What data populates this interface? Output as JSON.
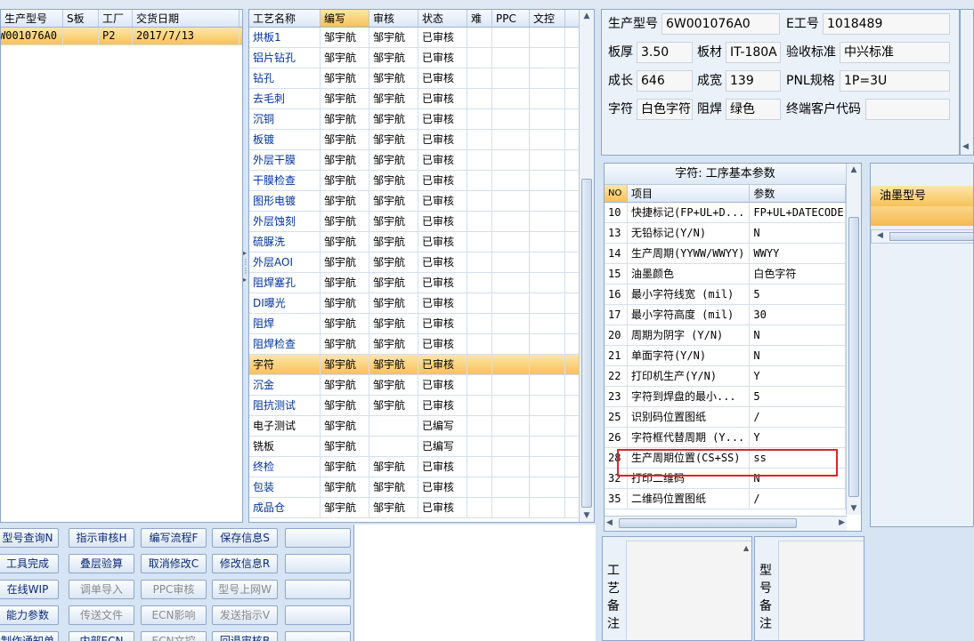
{
  "order_list": {
    "headers": [
      "生产型号",
      "S板",
      "工厂",
      "交货日期"
    ],
    "rows": [
      [
        "W001076A0",
        "",
        "P2",
        "2017/7/13"
      ]
    ]
  },
  "process_list": {
    "headers": [
      "工艺名称",
      "编写",
      "审核",
      "状态",
      "难",
      "PPC",
      "文控"
    ],
    "rows": [
      [
        "烘板1",
        "邹宇航",
        "邹宇航",
        "已审核"
      ],
      [
        "铝片钻孔",
        "邹宇航",
        "邹宇航",
        "已审核"
      ],
      [
        "钻孔",
        "邹宇航",
        "邹宇航",
        "已审核"
      ],
      [
        "去毛刺",
        "邹宇航",
        "邹宇航",
        "已审核"
      ],
      [
        "沉铜",
        "邹宇航",
        "邹宇航",
        "已审核"
      ],
      [
        "板镀",
        "邹宇航",
        "邹宇航",
        "已审核"
      ],
      [
        "外层干膜",
        "邹宇航",
        "邹宇航",
        "已审核"
      ],
      [
        "干膜检查",
        "邹宇航",
        "邹宇航",
        "已审核"
      ],
      [
        "图形电镀",
        "邹宇航",
        "邹宇航",
        "已审核"
      ],
      [
        "外层蚀刻",
        "邹宇航",
        "邹宇航",
        "已审核"
      ],
      [
        "硫脲洗",
        "邹宇航",
        "邹宇航",
        "已审核"
      ],
      [
        "外层AOI",
        "邹宇航",
        "邹宇航",
        "已审核"
      ],
      [
        "阻焊塞孔",
        "邹宇航",
        "邹宇航",
        "已审核"
      ],
      [
        "DI曝光",
        "邹宇航",
        "邹宇航",
        "已审核"
      ],
      [
        "阻焊",
        "邹宇航",
        "邹宇航",
        "已审核"
      ],
      [
        "阻焊检查",
        "邹宇航",
        "邹宇航",
        "已审核"
      ],
      [
        "字符",
        "邹宇航",
        "邹宇航",
        "已审核"
      ],
      [
        "沉金",
        "邹宇航",
        "邹宇航",
        "已审核"
      ],
      [
        "阻抗测试",
        "邹宇航",
        "邹宇航",
        "已审核"
      ],
      [
        "电子测试",
        "邹宇航",
        "",
        "已编写"
      ],
      [
        "铣板",
        "邹宇航",
        "",
        "已编写"
      ],
      [
        "终检",
        "邹宇航",
        "邹宇航",
        "已审核"
      ],
      [
        "包装",
        "邹宇航",
        "邹宇航",
        "已审核"
      ],
      [
        "成品仓",
        "邹宇航",
        "邹宇航",
        "已审核"
      ]
    ],
    "selected_index": 16
  },
  "buttons": [
    [
      "型号查询N",
      "指示审核H",
      "编写流程F",
      "保存信息S",
      ""
    ],
    [
      "工具完成",
      "叠层验算",
      "取消修改C",
      "修改信息R",
      ""
    ],
    [
      "在线WIP",
      "调单导入",
      "PPC审核",
      "型号上网W",
      ""
    ],
    [
      "能力参数",
      "传送文件",
      "ECN影响",
      "发送指示V",
      ""
    ],
    [
      "制作通知单",
      "内部ECN",
      "ECN文控",
      "回退审核B",
      ""
    ]
  ],
  "disabled_buttons": [
    "调单导入",
    "PPC审核",
    "型号上网W",
    "传送文件",
    "ECN影响",
    "发送指示V",
    "ECN文控"
  ],
  "info": {
    "prod_model_label": "生产型号",
    "prod_model": "6W001076A0",
    "e_no_label": "E工号",
    "e_no": "1018489",
    "thickness_label": "板厚",
    "thickness": "3.50",
    "material_label": "板材",
    "material": "IT-180A",
    "standard_label": "验收标准",
    "standard": "中兴标准",
    "length_label": "成长",
    "length": "646",
    "width_label": "成宽",
    "width": "139",
    "pnl_label": "PNL规格",
    "pnl": "1P=3U",
    "char_label": "字符",
    "char": "白色字符",
    "mask_label": "阻焊",
    "mask": "绿色",
    "customer_code_label": "终端客户代码",
    "customer_code": ""
  },
  "params": {
    "title": "字符: 工序基本参数",
    "headers": [
      "NO",
      "项目",
      "参数"
    ],
    "rows": [
      [
        "10",
        "快捷标记(FP+UL+D...",
        "FP+UL+DATECODE"
      ],
      [
        "13",
        "无铅标记(Y/N)",
        "N"
      ],
      [
        "14",
        "生产周期(YYWW/WWYY)",
        "WWYY"
      ],
      [
        "15",
        "油墨颜色",
        "白色字符"
      ],
      [
        "16",
        "最小字符线宽 (mil)",
        "5"
      ],
      [
        "17",
        "最小字符高度 (mil)",
        "30"
      ],
      [
        "20",
        "周期为阴字 (Y/N)",
        "N"
      ],
      [
        "21",
        "单面字符(Y/N)",
        "N"
      ],
      [
        "22",
        "打印机生产(Y/N)",
        "Y"
      ],
      [
        "23",
        "字符到焊盘的最小...",
        "5"
      ],
      [
        "25",
        "识别码位置图纸",
        "/"
      ],
      [
        "26",
        "字符框代替周期 (Y...",
        "Y"
      ],
      [
        "28",
        "生产周期位置(CS+SS)",
        "ss"
      ],
      [
        "32",
        "打印二维码",
        "N"
      ],
      [
        "35",
        "二维码位置图纸",
        "/"
      ]
    ],
    "highlight_index": 12
  },
  "ink": {
    "header": "油墨型号"
  },
  "notes": {
    "process_label": "工艺备注",
    "model_label": "型号备注"
  }
}
